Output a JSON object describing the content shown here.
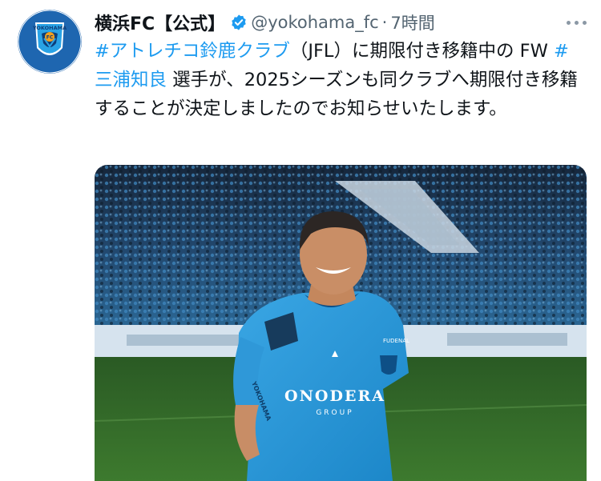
{
  "tweet": {
    "display_name": "横浜FC【公式】",
    "handle": "@yokohama_fc",
    "separator": "·",
    "time": "7時間",
    "text_parts": [
      {
        "text": "#アトレチコ鈴鹿クラブ",
        "hashtag": true
      },
      {
        "text": "（JFL）に期限付き移籍中の FW ",
        "hashtag": false
      },
      {
        "text": "#三浦知良",
        "hashtag": true
      },
      {
        "text": " 選手が、2025シーズンも同クラブへ期限付き移籍することが決定しましたのでお知らせいたします。",
        "hashtag": false
      }
    ],
    "avatar": {
      "logo_text": "YOKOHAMA",
      "badge_text": "FC"
    },
    "media": {
      "jersey_sponsor": "ONODERA",
      "jersey_sponsor_sub": "GROUP",
      "sleeve_text": "YOKOHAMA",
      "chest_patch": "FUDENAL"
    }
  },
  "colors": {
    "accent": "#1d9bf0",
    "text": "#0f1419",
    "secondary": "#536471",
    "team_blue": "#1d8fd1"
  },
  "icons": {
    "verified": "verified-badge-icon",
    "more": "more-options-icon"
  }
}
